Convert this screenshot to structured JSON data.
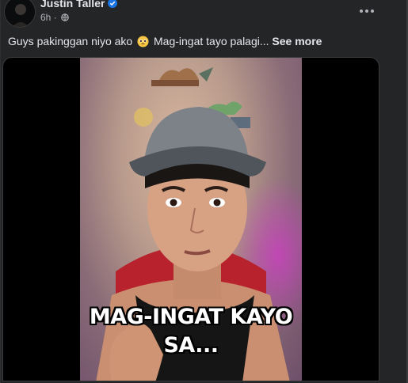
{
  "post": {
    "author_name": "Justin Taller",
    "verified": true,
    "timestamp": "6h",
    "meta_separator": " · ",
    "audience_icon": "globe-icon",
    "caption_before": "Guys pakinggan niyo ako ",
    "caption_emoji": "pleading-face-emoji",
    "caption_after": " Mag-ingat tayo palagi... ",
    "see_more_label": "See more"
  },
  "video": {
    "subtitle_line1": "MAG-INGAT KAYO",
    "subtitle_line2": "SA..."
  },
  "colors": {
    "background": "#242526",
    "text_primary": "#e4e6eb",
    "text_secondary": "#b0b3b8",
    "verified_blue": "#1b74e4"
  }
}
